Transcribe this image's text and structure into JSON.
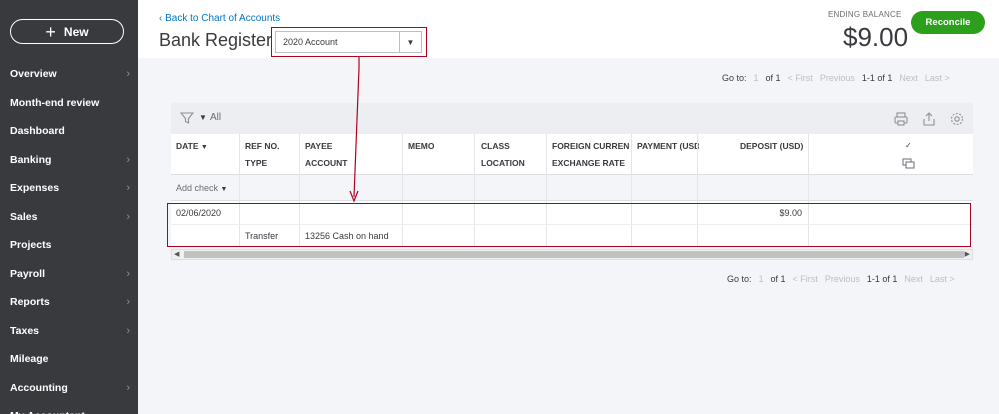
{
  "sidebar": {
    "new_label": "New",
    "items": [
      {
        "label": "Overview",
        "chevron": true
      },
      {
        "label": "Month-end review",
        "chevron": false
      },
      {
        "label": "Dashboard",
        "chevron": false
      },
      {
        "label": "Banking",
        "chevron": true
      },
      {
        "label": "Expenses",
        "chevron": true
      },
      {
        "label": "Sales",
        "chevron": true
      },
      {
        "label": "Projects",
        "chevron": false
      },
      {
        "label": "Payroll",
        "chevron": true
      },
      {
        "label": "Reports",
        "chevron": true
      },
      {
        "label": "Taxes",
        "chevron": true
      },
      {
        "label": "Mileage",
        "chevron": false
      },
      {
        "label": "Accounting",
        "chevron": true
      },
      {
        "label": "My Accountant",
        "chevron": false
      }
    ]
  },
  "header": {
    "back_link": "Back to Chart of Accounts",
    "title": "Bank Register",
    "account_select": "2020 Account",
    "ending_balance_label": "ENDING BALANCE",
    "ending_balance": "$9.00",
    "reconcile_label": "Reconcile"
  },
  "pager": {
    "goto": "Go to:",
    "page": "1",
    "of": "of 1",
    "first": "< First",
    "previous": "Previous",
    "range": "1-1 of 1",
    "next": "Next",
    "last": "Last >"
  },
  "toolbar": {
    "filter_label": "All"
  },
  "columns": {
    "date": "DATE",
    "ref": "REF NO.",
    "type": "TYPE",
    "payee": "PAYEE",
    "account": "ACCOUNT",
    "memo": "MEMO",
    "class": "CLASS",
    "location": "LOCATION",
    "foreign": "FOREIGN CURRENCY",
    "exchange": "EXCHANGE RATE",
    "payment": "PAYMENT (USD)",
    "deposit": "DEPOSIT (USD)",
    "check_mark": "✓"
  },
  "add_check": "Add check",
  "rows": [
    {
      "date": "02/06/2020",
      "type": "Transfer",
      "account": "13256 Cash on hand",
      "deposit": "$9.00"
    }
  ],
  "colors": {
    "sidebar": "#393a3d",
    "accent_green": "#2ca01c",
    "link_blue": "#0077c5",
    "annotation_red": "#b00020"
  }
}
